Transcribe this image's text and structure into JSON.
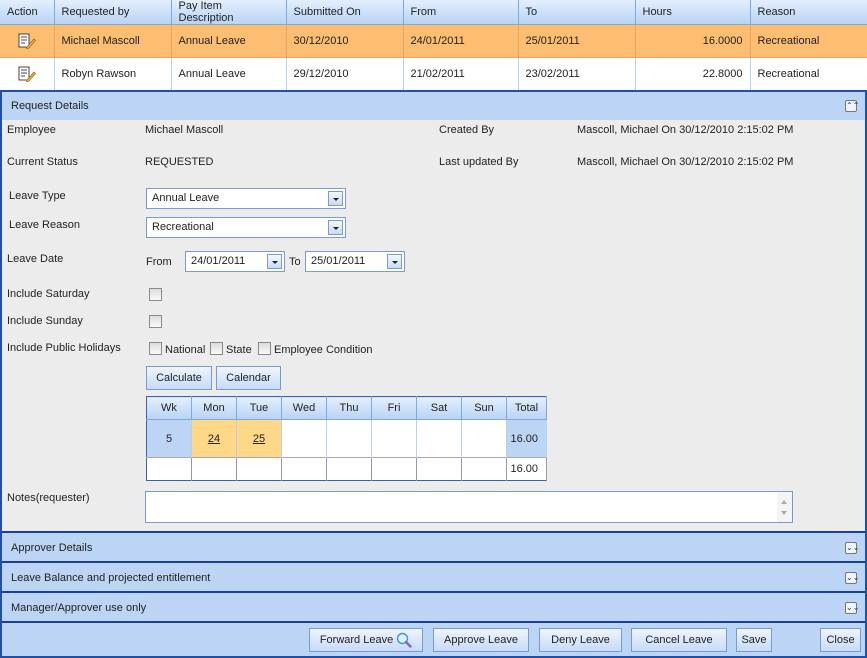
{
  "grid": {
    "columns": [
      "Action",
      "Requested by",
      "Pay Item Description",
      "Submitted On",
      "From",
      "To",
      "Hours",
      "Reason"
    ],
    "rows": [
      {
        "action_icon": "edit-document-icon",
        "requested_by": "Michael Mascoll",
        "pay_item": "Annual Leave",
        "submitted_on": "30/12/2010",
        "from": "24/01/2011",
        "to": "25/01/2011",
        "hours": "16.0000",
        "reason": "Recreational",
        "selected": true
      },
      {
        "action_icon": "edit-document-icon",
        "requested_by": "Robyn Rawson",
        "pay_item": "Annual Leave",
        "submitted_on": "29/12/2010",
        "from": "21/02/2011",
        "to": "23/02/2011",
        "hours": "22.8000",
        "reason": "Recreational",
        "selected": false
      }
    ]
  },
  "request_details": {
    "title": "Request Details",
    "collapse_icon": "double-chevron-up-icon",
    "employee_label": "Employee",
    "employee_value": "Michael Mascoll",
    "status_label": "Current Status",
    "status_value": "REQUESTED",
    "created_by_label": "Created By",
    "created_by_value": "Mascoll, Michael On 30/12/2010 2:15:02 PM",
    "updated_by_label": "Last updated By",
    "updated_by_value": "Mascoll, Michael On 30/12/2010 2:15:02 PM",
    "leave_type_label": "Leave Type",
    "leave_type_value": "Annual Leave",
    "leave_reason_label": "Leave Reason",
    "leave_reason_value": "Recreational",
    "leave_date_label": "Leave Date",
    "from_label": "From",
    "from_value": "24/01/2011",
    "to_label": "To",
    "to_value": "25/01/2011",
    "include_saturday_label": "Include Saturday",
    "include_saturday_checked": false,
    "include_sunday_label": "Include Sunday",
    "include_sunday_checked": false,
    "include_holidays_label": "Include Public Holidays",
    "holiday_options": [
      {
        "label": "National",
        "checked": false
      },
      {
        "label": "State",
        "checked": false
      },
      {
        "label": "Employee Condition",
        "checked": false
      }
    ],
    "calculate_label": "Calculate",
    "calendar_label": "Calendar",
    "notes_label": "Notes(requester)",
    "notes_value": ""
  },
  "calendar": {
    "headers": [
      "Wk",
      "Mon",
      "Tue",
      "Wed",
      "Thu",
      "Fri",
      "Sat",
      "Sun",
      "Total"
    ],
    "week": "5",
    "days": [
      "24",
      "25",
      "",
      "",
      "",
      "",
      ""
    ],
    "week_total": "16.00",
    "grand_total": "16.00"
  },
  "sections": [
    {
      "title": "Approver Details",
      "icon": "double-chevron-down-icon"
    },
    {
      "title": "Leave Balance and projected entitlement",
      "icon": "double-chevron-down-icon"
    },
    {
      "title": "Manager/Approver use only",
      "icon": "double-chevron-down-icon"
    }
  ],
  "footer": {
    "forward_label": "Forward Leave",
    "approve_label": "Approve Leave",
    "deny_label": "Deny Leave",
    "cancel_label": "Cancel Leave",
    "save_label": "Save",
    "close_label": "Close"
  },
  "colors": {
    "selected_row": "#fdbe72",
    "header_blue": "#bcd5f5",
    "border_dark_blue": "#1d3f95",
    "leave_day": "#fed787"
  }
}
